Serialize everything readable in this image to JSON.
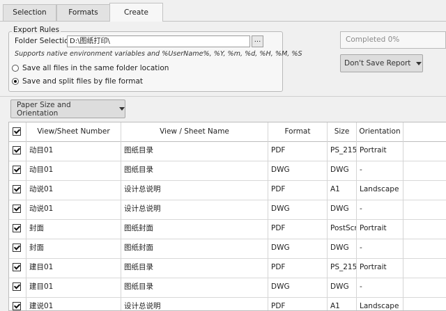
{
  "tabs": [
    {
      "label": "Selection"
    },
    {
      "label": "Formats"
    },
    {
      "label": "Create"
    }
  ],
  "export_rules": {
    "legend": "Export Rules",
    "folder_label": "Folder Selection",
    "folder_value": "D:\\图纸打印\\",
    "browse_label": "...",
    "hint": "Supports native environment variables and %UserName%, %Y, %m, %d, %H, %M, %S",
    "option_same_folder": "Save all files in the same folder location",
    "option_split_format": "Save and split files by file format",
    "selected_option": "split"
  },
  "progress_text": "Completed 0%",
  "report_button": "Don't Save Report",
  "paper_button": "Paper Size and Orientation",
  "table": {
    "headers": [
      "View/Sheet Number",
      "View / Sheet Name",
      "Format",
      "Size",
      "Orientation"
    ],
    "rows": [
      {
        "number": "动目01",
        "name": "图纸目录",
        "format": "PDF",
        "size": "PS_215",
        "orientation": "Portrait"
      },
      {
        "number": "动目01",
        "name": "图纸目录",
        "format": "DWG",
        "size": "DWG",
        "orientation": "-"
      },
      {
        "number": "动说01",
        "name": "设计总说明",
        "format": "PDF",
        "size": "A1",
        "orientation": "Landscape"
      },
      {
        "number": "动说01",
        "name": "设计总说明",
        "format": "DWG",
        "size": "DWG",
        "orientation": "-"
      },
      {
        "number": "封面",
        "name": "图纸封面",
        "format": "PDF",
        "size": "PostScr",
        "orientation": "Portrait"
      },
      {
        "number": "封面",
        "name": "图纸封面",
        "format": "DWG",
        "size": "DWG",
        "orientation": "-"
      },
      {
        "number": "建目01",
        "name": "图纸目录",
        "format": "PDF",
        "size": "PS_215",
        "orientation": "Portrait"
      },
      {
        "number": "建目01",
        "name": "图纸目录",
        "format": "DWG",
        "size": "DWG",
        "orientation": "-"
      },
      {
        "number": "建说01",
        "name": "设计总说明",
        "format": "PDF",
        "size": "A1",
        "orientation": "Landscape"
      }
    ]
  }
}
